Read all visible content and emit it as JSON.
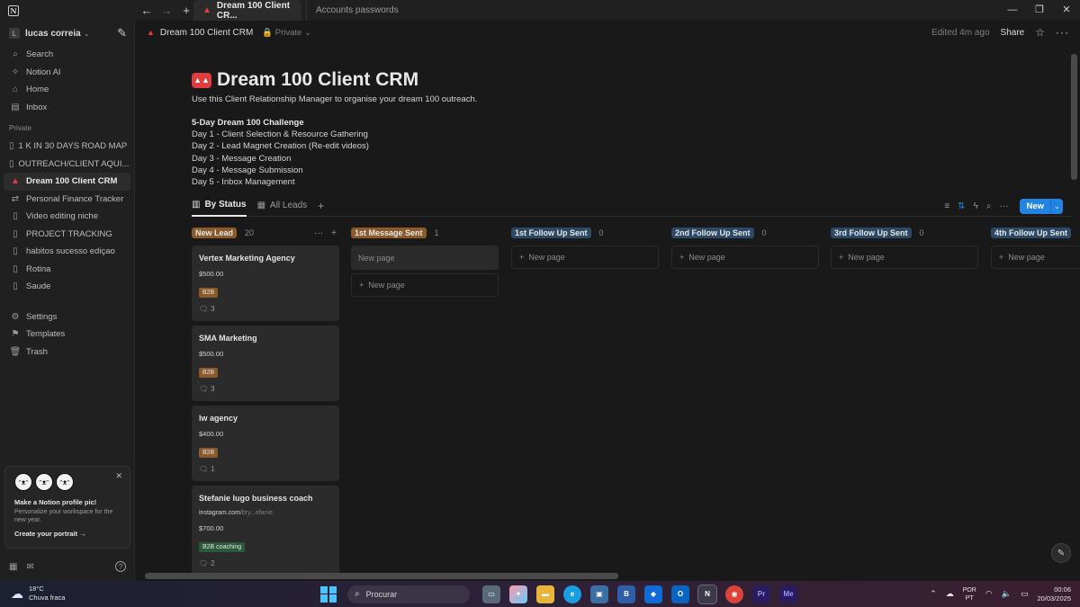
{
  "window": {
    "tabs": [
      {
        "label": "Dream 100 Client CR...",
        "active": true
      },
      {
        "label": "Accounts passwords",
        "active": false
      }
    ],
    "controls": {
      "minimize": "—",
      "restore": "❐",
      "close": "✕"
    }
  },
  "sidebar": {
    "workspace": {
      "initial": "L",
      "name": "lucas correia"
    },
    "top_items": [
      {
        "label": "Search",
        "icon": "search-icon"
      },
      {
        "label": "Notion AI",
        "icon": "sparkle-icon"
      },
      {
        "label": "Home",
        "icon": "home-icon"
      },
      {
        "label": "Inbox",
        "icon": "inbox-icon"
      }
    ],
    "section_label": "Private",
    "pages": [
      {
        "label": "1 K IN 30 DAYS ROAD MAP",
        "icon": "page-icon"
      },
      {
        "label": "OUTREACH/CLIENT AQUI...",
        "icon": "page-icon"
      },
      {
        "label": "Dream 100 Client CRM",
        "icon": "crm-icon",
        "selected": true
      },
      {
        "label": "Personal Finance Tracker",
        "icon": "finance-icon"
      },
      {
        "label": "Video editing niche",
        "icon": "page-icon"
      },
      {
        "label": "PROJECT TRACKING",
        "icon": "page-icon"
      },
      {
        "label": "habitos sucesso ediçao",
        "icon": "page-icon"
      },
      {
        "label": "Rotina",
        "icon": "page-icon"
      },
      {
        "label": "Saude",
        "icon": "page-icon"
      }
    ],
    "bottom_items": [
      {
        "label": "Settings",
        "icon": "gear-icon"
      },
      {
        "label": "Templates",
        "icon": "templates-icon"
      },
      {
        "label": "Trash",
        "icon": "trash-icon"
      }
    ],
    "promo": {
      "title": "Make a Notion profile pic!",
      "description": "Personalize your workspace for the new year.",
      "link": "Create your portrait"
    }
  },
  "topbar": {
    "breadcrumb": "Dream 100 Client CRM",
    "privacy": "Private",
    "edited": "Edited 4m ago",
    "share": "Share"
  },
  "page": {
    "title": "Dream 100 Client CRM",
    "description": "Use this Client Relationship Manager to organise your dream 100 outreach.",
    "challenge_title": "5-Day Dream 100 Challenge",
    "challenge_days": [
      "Day 1 - Client Selection & Resource Gathering",
      "Day 2 - Lead Magnet Creation (Re-edit videos)",
      "Day 3 - Message Creation",
      "Day 4 - Message Submission",
      "Day 5 - Inbox Management"
    ]
  },
  "views": {
    "tabs": [
      "By Status",
      "All Leads"
    ],
    "new_button": "New"
  },
  "board": {
    "new_page_label": "New page",
    "columns": [
      {
        "name": "New Lead",
        "count": "20",
        "color": "#8a5a2b",
        "cards": [
          {
            "title": "Vertex Marketing Agency",
            "price": "$500.00",
            "tag": "B2B",
            "comments": "3"
          },
          {
            "title": "SMA Marketing",
            "price": "$500.00",
            "tag": "B2B",
            "comments": "3"
          },
          {
            "title": "lw agency",
            "price": "$400.00",
            "tag": "B2B",
            "comments": "1"
          },
          {
            "title": "Stefanie lugo business coach",
            "link_main": "instagram.com",
            "link_dim": "/bry...efanie",
            "price": "$700.00",
            "tag": "B2B coaching",
            "comments": "2"
          }
        ]
      },
      {
        "name": "1st Message Sent",
        "count": "1",
        "color": "#8a5a2b"
      },
      {
        "name": "1st Follow Up Sent",
        "count": "0",
        "color": "#2c4a66"
      },
      {
        "name": "2nd Follow Up Sent",
        "count": "0",
        "color": "#2c4a66"
      },
      {
        "name": "3rd Follow Up Sent",
        "count": "0",
        "color": "#2c4a66"
      },
      {
        "name": "4th Follow Up Sent",
        "count": "",
        "color": "#2c4a66"
      }
    ]
  },
  "taskbar": {
    "weather_temp": "18°C",
    "weather_desc": "Chuva fraca",
    "search_placeholder": "Procurar",
    "lang_1": "POR",
    "lang_2": "PT",
    "time": "00:06",
    "date": "20/03/2025"
  },
  "colors": {
    "accent": "#2383e2",
    "brand_red": "#e03e3e",
    "tag_b2b": "#8a5a2b",
    "tag_b2b_coaching": "#2b5a3a"
  }
}
